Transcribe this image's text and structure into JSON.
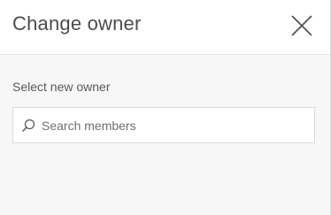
{
  "dialog": {
    "title": "Change owner",
    "close_icon": "close-icon"
  },
  "owner_field": {
    "label": "Select new owner",
    "search_placeholder": "Search members",
    "search_value": "",
    "search_icon": "search-icon"
  },
  "colors": {
    "header_bg": "#ffffff",
    "body_bg": "#f7f7f7",
    "title_text": "#4c4c4c",
    "label_text": "#595959",
    "placeholder_text": "#6e6e6e",
    "border": "#dadada"
  }
}
